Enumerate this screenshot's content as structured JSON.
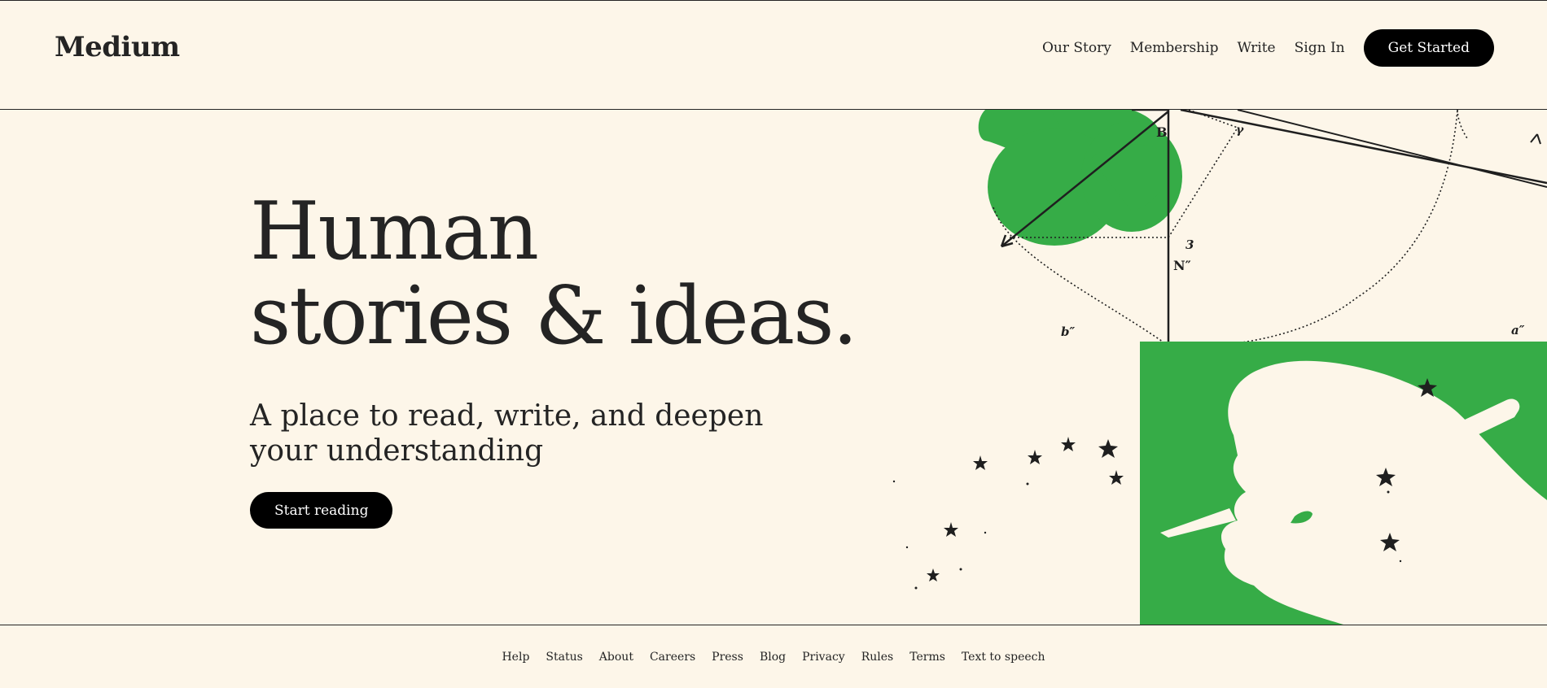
{
  "brand": {
    "logo": "Medium",
    "accent_green": "#36ac47",
    "background": "#fdf6e9",
    "text": "#242424"
  },
  "nav": {
    "links": [
      {
        "label": "Our Story"
      },
      {
        "label": "Membership"
      },
      {
        "label": "Write"
      },
      {
        "label": "Sign In"
      }
    ],
    "cta": "Get Started"
  },
  "hero": {
    "title_line1": "Human",
    "title_line2": "stories & ideas.",
    "subtitle": "A place to read, write, and deepen your understanding",
    "cta": "Start reading",
    "illustration": {
      "icon": "hand-writing-illustration",
      "labels": [
        "B",
        "γ",
        "3",
        "N″",
        "b″",
        "E",
        "a″"
      ]
    }
  },
  "footer": {
    "links": [
      {
        "label": "Help"
      },
      {
        "label": "Status"
      },
      {
        "label": "About"
      },
      {
        "label": "Careers"
      },
      {
        "label": "Press"
      },
      {
        "label": "Blog"
      },
      {
        "label": "Privacy"
      },
      {
        "label": "Rules"
      },
      {
        "label": "Terms"
      },
      {
        "label": "Text to speech"
      }
    ]
  }
}
